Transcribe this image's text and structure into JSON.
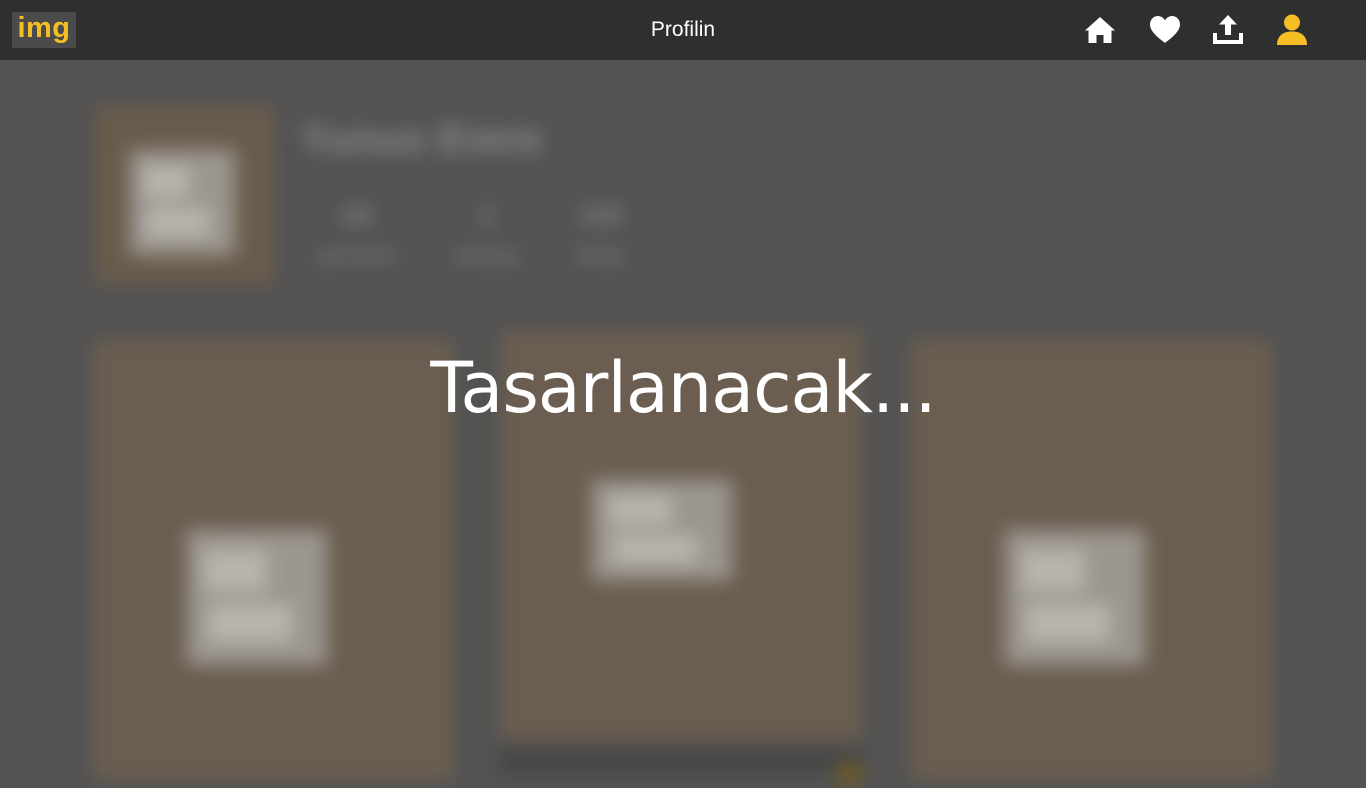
{
  "header": {
    "logo_text": "img",
    "title": "Profilin",
    "icons": [
      "home-icon",
      "heart-icon",
      "upload-icon",
      "user-icon"
    ]
  },
  "profile": {
    "name": "Yunus Emre",
    "stats": [
      {
        "value": "88",
        "label": "gönderi"
      },
      {
        "value": "2",
        "label": "takipçi"
      },
      {
        "value": "198",
        "label": "takip"
      }
    ]
  },
  "overlay": {
    "message": "Tasarlanacak..."
  },
  "colors": {
    "accent": "#f6be25",
    "topbar": "#2f2f2f",
    "background": "#535353"
  }
}
